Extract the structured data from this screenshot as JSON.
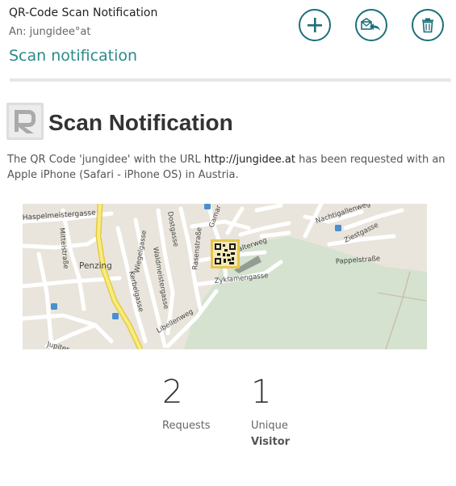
{
  "header": {
    "subject": "QR-Code Scan Notification",
    "recipient": "An: jungidee°at",
    "title": "Scan notification"
  },
  "toolbar": {
    "new_icon": "plus-icon",
    "reply_icon": "reply-icon",
    "delete_icon": "trash-icon"
  },
  "body": {
    "headline": "Scan Notification",
    "message_before": "The QR Code 'jungidee' with the URL ",
    "url": "http://jungidee.at",
    "message_after": " has been requested with an Apple iPhone (Safari - iPhone OS) in Austria."
  },
  "map": {
    "streets": [
      "Haspelmeistergasse",
      "Mittelstraße",
      "Penzing",
      "Kerbelgasse",
      "Wiegelgasse",
      "Waldmeistergasse",
      "Dostgasse",
      "Gamar",
      "Nachtigallenweg",
      "Pappelstraße",
      "Ziestgasse",
      "Zyklamengasse",
      "Libellenweg",
      "Jupiter",
      "Rasenstraße",
      "Falterweg"
    ]
  },
  "stats": [
    {
      "value": "2",
      "label": "Requests",
      "sub": ""
    },
    {
      "value": "1",
      "label": "Unique",
      "sub": "Visitor"
    }
  ],
  "colors": {
    "accent": "#2a8a8a",
    "button": "#1d6f7a",
    "divider": "#e7e7e7"
  }
}
